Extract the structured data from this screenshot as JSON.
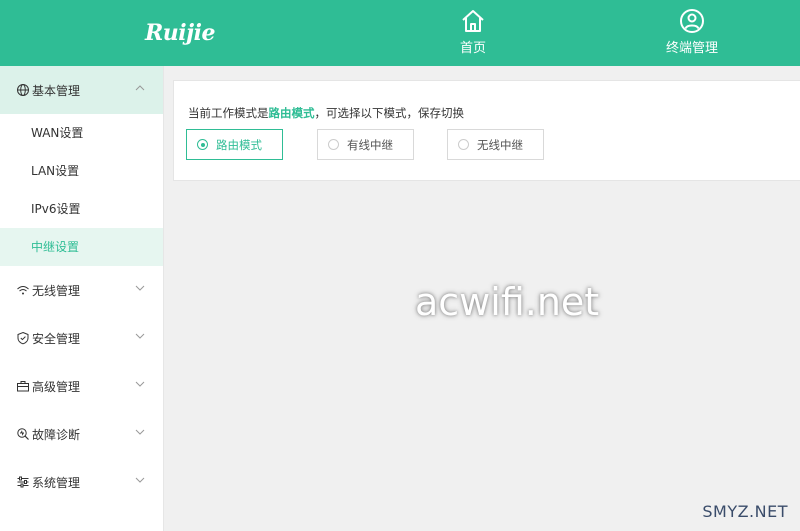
{
  "header": {
    "logo_text": "Ruijie",
    "nav": [
      {
        "label": "首页",
        "icon": "home-icon"
      },
      {
        "label": "终端管理",
        "icon": "user-circle-icon"
      }
    ],
    "bg_color": "#2fbd95"
  },
  "sidebar": {
    "groups": [
      {
        "label": "基本管理",
        "icon": "globe-icon",
        "expanded": true
      },
      {
        "label": "无线管理",
        "icon": "wifi-icon",
        "expanded": false
      },
      {
        "label": "安全管理",
        "icon": "shield-icon",
        "expanded": false
      },
      {
        "label": "高级管理",
        "icon": "toolbox-icon",
        "expanded": false
      },
      {
        "label": "故障诊断",
        "icon": "diagnose-icon",
        "expanded": false
      },
      {
        "label": "系统管理",
        "icon": "sliders-icon",
        "expanded": false
      }
    ],
    "sub_items": [
      {
        "label": "WAN设置",
        "active": false
      },
      {
        "label": "LAN设置",
        "active": false
      },
      {
        "label": "IPv6设置",
        "active": false
      },
      {
        "label": "中继设置",
        "active": true
      }
    ]
  },
  "main": {
    "mode_prefix": "当前工作模式是",
    "mode_current": "路由模式",
    "mode_suffix": "，可选择以下模式，保存切换",
    "options": [
      {
        "label": "路由模式",
        "checked": true
      },
      {
        "label": "有线中继",
        "checked": false
      },
      {
        "label": "无线中继",
        "checked": false
      }
    ]
  },
  "watermark": "acwifi.net",
  "corner_watermark": "SMYZ.NET",
  "accent_color": "#2fbd95"
}
